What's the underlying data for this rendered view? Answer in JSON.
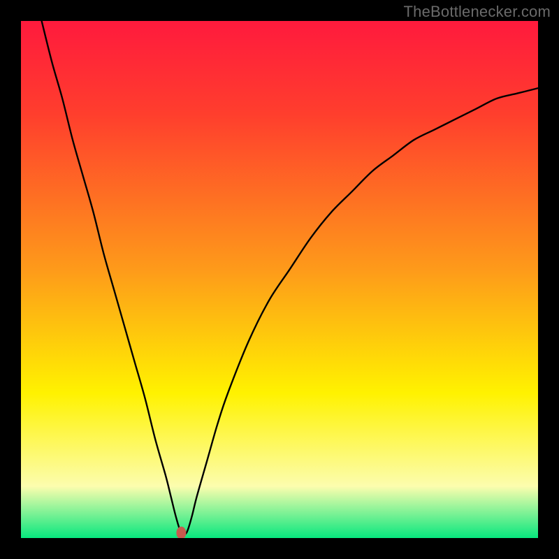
{
  "watermark": "TheBottlenecker.com",
  "chart_data": {
    "type": "line",
    "title": "",
    "xlabel": "",
    "ylabel": "",
    "xlim": [
      0,
      100
    ],
    "ylim": [
      0,
      100
    ],
    "bg_gradient": {
      "top": "#ff1a3d",
      "mid_red": "#ff3e2d",
      "mid_orange": "#fe9a1a",
      "mid_yellow": "#fff200",
      "pale_yellow": "#fcfdae",
      "green": "#07e77e"
    },
    "minimum_marker": {
      "x": 31,
      "y": 1,
      "color": "#c65a4e"
    },
    "series": [
      {
        "name": "bottleneck-curve",
        "x": [
          4,
          6,
          8,
          10,
          12,
          14,
          16,
          18,
          20,
          22,
          24,
          26,
          28,
          29,
          30,
          31,
          32,
          33,
          34,
          36,
          38,
          40,
          44,
          48,
          52,
          56,
          60,
          64,
          68,
          72,
          76,
          80,
          84,
          88,
          92,
          96,
          100
        ],
        "y": [
          100,
          92,
          85,
          77,
          70,
          63,
          55,
          48,
          41,
          34,
          27,
          19,
          12,
          8,
          4,
          1,
          1,
          4,
          8,
          15,
          22,
          28,
          38,
          46,
          52,
          58,
          63,
          67,
          71,
          74,
          77,
          79,
          81,
          83,
          85,
          86,
          87
        ]
      }
    ]
  }
}
